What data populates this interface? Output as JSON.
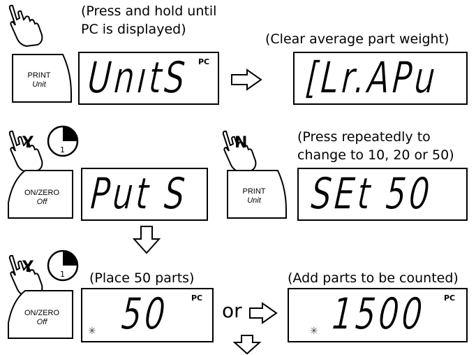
{
  "captions": {
    "hold_line1": "(Press and hold until",
    "hold_line2": "PC is displayed)",
    "clear": "(Clear average part weight)",
    "repeat_line1": "(Press repeatedly to",
    "repeat_line2": "change to 10, 20 or 50)",
    "place": "(Place 50 parts)",
    "add": "(Add parts to be counted)"
  },
  "displays": {
    "units": {
      "text": "UnıtS",
      "indicator": "PC"
    },
    "clear": {
      "text": "[Lr.APu"
    },
    "put": {
      "text": "Put S"
    },
    "set": {
      "text": "SEt 50"
    },
    "fifty": {
      "text": "50",
      "indicator": "PC",
      "marker": "✳"
    },
    "count": {
      "text": "1500",
      "indicator": "PC",
      "marker": "✳"
    }
  },
  "keys": {
    "print_top": {
      "label": "PRINT",
      "sub": "Unit"
    },
    "onzero_mid": {
      "label": "ON/ZERO",
      "sub": "Off"
    },
    "print_mid": {
      "label": "PRINT",
      "sub": "Unit"
    },
    "onzero_bot": {
      "label": "ON/ZERO",
      "sub": "Off"
    }
  },
  "hand_letters": {
    "yes_mid": "Y",
    "no_mid": "N",
    "yes_bot": "Y"
  },
  "timer": {
    "label_mid": "1",
    "label_bot": "1"
  },
  "or_text": "or"
}
